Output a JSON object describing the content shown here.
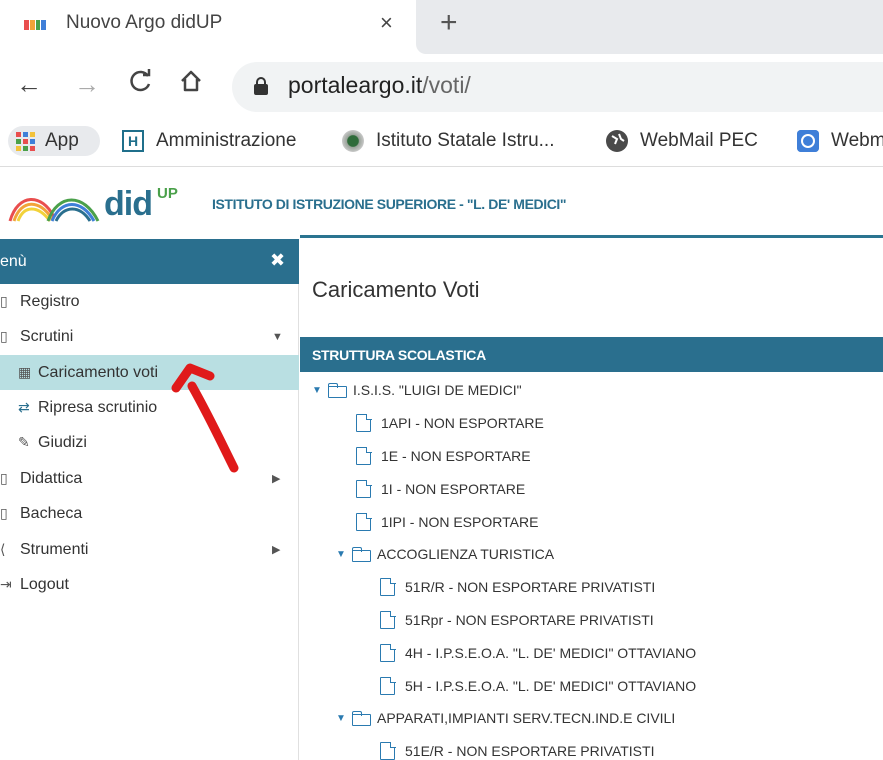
{
  "browser": {
    "tab_title": "Nuovo Argo didUP",
    "tab_close": "×",
    "new_tab": "+",
    "url_host": "portaleargo.it",
    "url_path": "/voti/",
    "nav": {
      "back": "←",
      "forward": "→",
      "reload": "C",
      "home": "⌂"
    },
    "bookmarks": [
      {
        "label": "App",
        "icon": "apps-grid-icon"
      },
      {
        "label": "Amministrazione",
        "icon": "h-icon",
        "glyph": "H"
      },
      {
        "label": "Istituto Statale Istru...",
        "icon": "emblem-icon"
      },
      {
        "label": "WebMail PEC",
        "icon": "globe-icon"
      },
      {
        "label": "Webm",
        "icon": "web-icon"
      }
    ]
  },
  "app": {
    "logo_did": "did",
    "logo_up": "UP",
    "school_name": "ISTITUTO DI ISTRUZIONE SUPERIORE - \"L. DE' MEDICI\""
  },
  "sidebar": {
    "menu_title": "enù",
    "close": "✖",
    "items": [
      {
        "label": "Registro",
        "icon": "▯"
      },
      {
        "label": "Scrutini",
        "icon": "▯",
        "arrow": "▼"
      },
      {
        "label": "Caricamento voti",
        "icon": "▦"
      },
      {
        "label": "Ripresa scrutinio",
        "icon": "⇄"
      },
      {
        "label": "Giudizi",
        "icon": "✎"
      },
      {
        "label": "Didattica",
        "icon": "▯",
        "arrow": "▶"
      },
      {
        "label": "Bacheca",
        "icon": "▯"
      },
      {
        "label": "Strumenti",
        "icon": "⟨",
        "arrow": "▶"
      },
      {
        "label": "Logout",
        "icon": "⇥"
      }
    ]
  },
  "main": {
    "title": "Caricamento Voti",
    "tree_header": "STRUTTURA SCOLASTICA",
    "tree": [
      {
        "label": "I.S.I.S. \"LUIGI DE MEDICI\""
      },
      {
        "label": "1API - NON ESPORTARE"
      },
      {
        "label": "1E - NON ESPORTARE"
      },
      {
        "label": "1I - NON ESPORTARE"
      },
      {
        "label": "1IPI - NON ESPORTARE"
      },
      {
        "label": "ACCOGLIENZA TURISTICA"
      },
      {
        "label": "51R/R - NON ESPORTARE PRIVATISTI"
      },
      {
        "label": "51Rpr - NON ESPORTARE PRIVATISTI"
      },
      {
        "label": "4H - I.P.S.E.O.A. \"L. DE' MEDICI\" OTTAVIANO"
      },
      {
        "label": "5H - I.P.S.E.O.A. \"L. DE' MEDICI\" OTTAVIANO"
      },
      {
        "label": "APPARATI,IMPIANTI SERV.TECN.IND.E CIVILI"
      },
      {
        "label": "51E/R - NON ESPORTARE PRIVATISTI"
      }
    ]
  },
  "colors": {
    "brand": "#2a6f8e",
    "active_item": "#b9dfe2",
    "tree_icon": "#2a7ab0",
    "annotation": "#e01a1a"
  }
}
